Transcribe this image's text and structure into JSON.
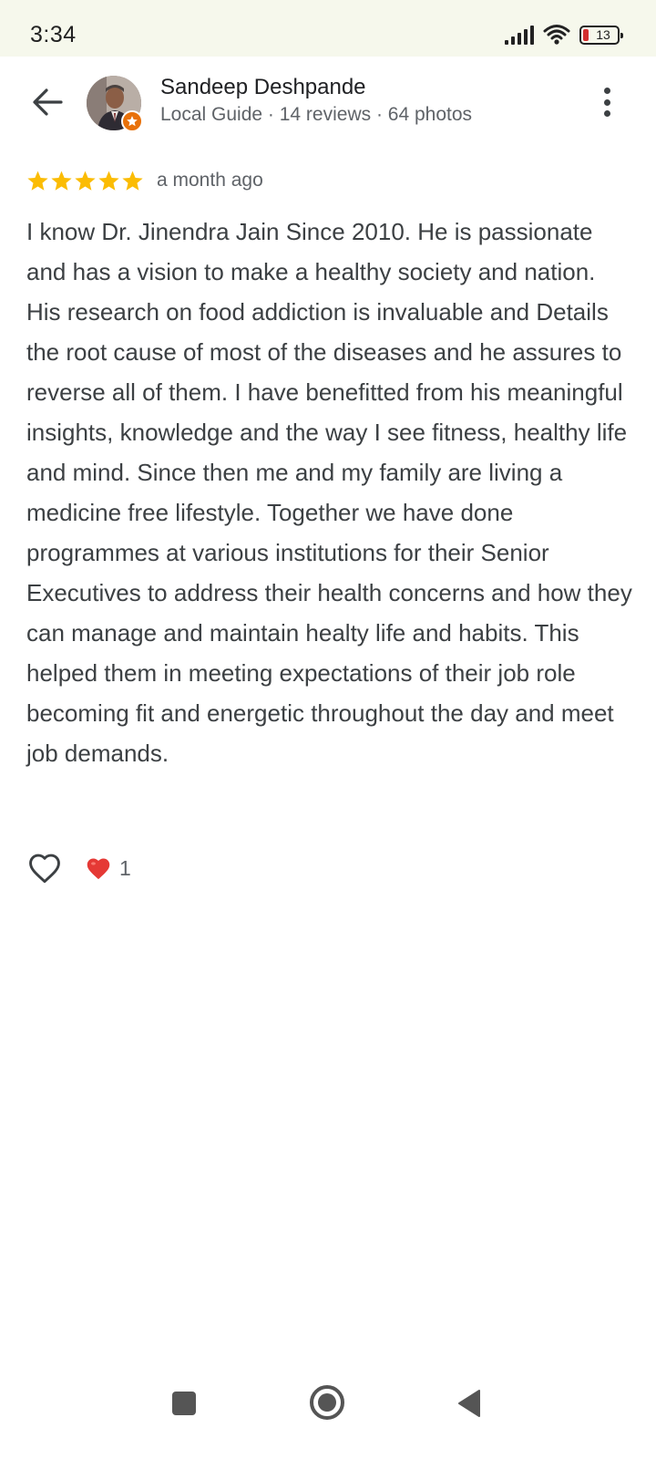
{
  "status_bar": {
    "time": "3:34",
    "battery": "13",
    "icons": [
      "signal-icon",
      "wifi-icon",
      "battery-icon"
    ]
  },
  "header": {
    "back_icon": "arrow-back-icon",
    "user_name": "Sandeep Deshpande",
    "user_meta": "Local Guide · 14 reviews · 64 photos",
    "avatar_badge_icon": "local-guide-star-icon",
    "more_icon": "more-vert-icon"
  },
  "review": {
    "rating": 5,
    "max_rating": 5,
    "time": "a month ago",
    "text": "I know Dr. Jinendra Jain Since 2010. He is passionate and has a vision to make a healthy society and nation. His research on food addiction is invaluable and Details the root cause of most of the diseases and he assures to reverse all of them. I have benefitted from his meaningful insights, knowledge and the way I see fitness, healthy life and mind. Since then me and my family are living a medicine free lifestyle. Together we have done programmes at various institutions for their Senior Executives to address their health concerns and how they can manage and maintain healty life and habits. This helped them in meeting expectations of their job role becoming fit and energetic throughout the day and meet job demands."
  },
  "reactions": {
    "like_icon": "heart-outline-icon",
    "reaction_icon": "red-heart-icon",
    "count": "1"
  },
  "nav_bar": {
    "icons": [
      "recents-square-icon",
      "home-circle-icon",
      "back-triangle-icon"
    ]
  },
  "colors": {
    "status_bar_bg": "#f6f8ec",
    "star": "#fbbc04",
    "heart_red": "#e53935",
    "badge_orange": "#e8710a",
    "secondary_text": "#5f6368"
  }
}
